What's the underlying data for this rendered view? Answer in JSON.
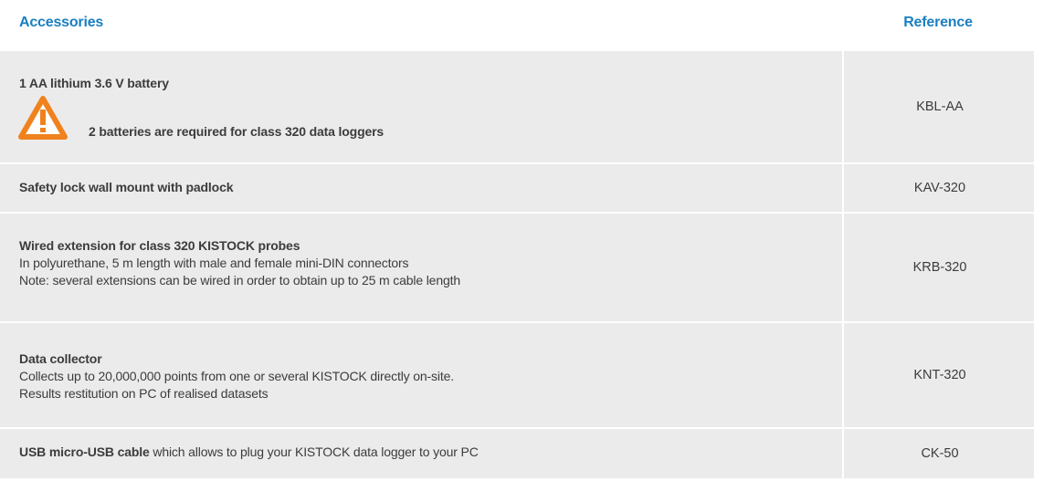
{
  "header": {
    "accessories": "Accessories",
    "reference": "Reference"
  },
  "rows": [
    {
      "title": "1 AA lithium 3.6 V battery",
      "warning": "2 batteries are required for class 320 data loggers",
      "reference": "KBL-AA"
    },
    {
      "title": "Safety lock wall mount with padlock",
      "reference": "KAV-320"
    },
    {
      "title": "Wired extension for class 320 KISTOCK probes",
      "line1": "In polyurethane, 5 m length with male and female mini-DIN connectors",
      "line2": "Note: several extensions can be wired in order to obtain up to 25 m cable length",
      "reference": "KRB-320"
    },
    {
      "title": "Data collector",
      "line1": "Collects up to 20,000,000 points from one or several KISTOCK directly on-site.",
      "line2": "Results restitution on PC of realised datasets",
      "reference": "KNT-320"
    },
    {
      "title_bold": "USB micro-USB cable",
      "title_rest": " which allows to plug your KISTOCK data logger to your PC",
      "reference": "CK-50"
    }
  ],
  "colors": {
    "header_text": "#1a7fc1",
    "row_background": "#ebebeb",
    "warning_icon": "#f0821e"
  },
  "icons": {
    "warning": "warning-triangle-icon"
  }
}
